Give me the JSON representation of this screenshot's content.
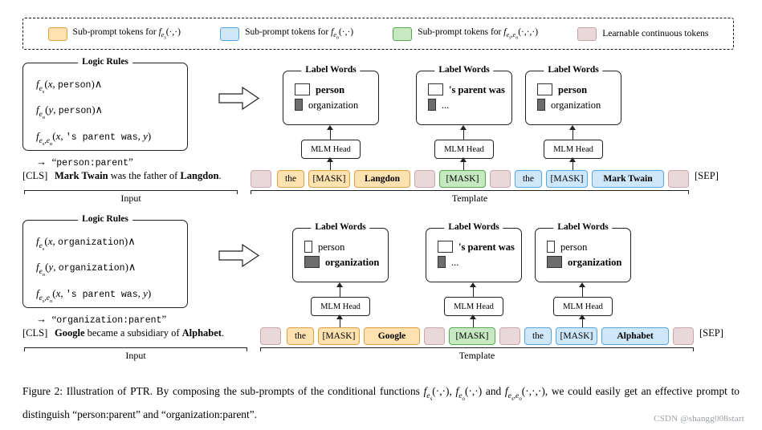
{
  "legend": {
    "items": [
      {
        "key": "es",
        "label": "Sub-prompt tokens for f_es(·,·)",
        "color": "#ffe2b0"
      },
      {
        "key": "eo",
        "label": "Sub-prompt tokens for f_eo(·,·)",
        "color": "#cfe7fb"
      },
      {
        "key": "eseo",
        "label": "Sub-prompt tokens for f_es,eo(·,·,·)",
        "color": "#c6e9c2"
      },
      {
        "key": "learn",
        "label": "Learnable continuous tokens",
        "color": "#ead7d9"
      }
    ]
  },
  "row1": {
    "logic": {
      "title": "Logic Rules",
      "lines": [
        "f_es(x, person)∧",
        "f_eo(y, person)∧",
        "f_es,eo(x, 's parent was, y)",
        "→ \"person:parent\""
      ],
      "l1_fn": "f",
      "l1_sub": "e_s",
      "l1_args": "(x, person)∧",
      "l2_fn": "f",
      "l2_sub": "e_o",
      "l2_args": "(y, person)∧",
      "l3_fn": "f",
      "l3_sub": "e_s,e_o",
      "l3_args": "(x, 's parent was, y)",
      "l4": "→ \"person:parent\""
    },
    "labelwords": [
      {
        "title": "Label Words",
        "lines": [
          "person",
          "organization"
        ],
        "bold_index": 0
      },
      {
        "title": "Label Words",
        "lines": [
          "'s parent was",
          "..."
        ],
        "bold_index": 0
      },
      {
        "title": "Label Words",
        "lines": [
          "person",
          "organization"
        ],
        "bold_index": 0
      }
    ],
    "mlm_label": "MLM Head",
    "sentence": {
      "cls": "[CLS]",
      "parts": [
        "Mark Twain",
        " was the father of ",
        "Langdon",
        "."
      ],
      "sep": "[SEP]"
    },
    "tokens": [
      {
        "type": "learn",
        "text": ""
      },
      {
        "type": "es",
        "text": "the"
      },
      {
        "type": "es",
        "text": "[MASK]"
      },
      {
        "type": "es",
        "text": "Langdon",
        "bold": true
      },
      {
        "type": "learn",
        "text": ""
      },
      {
        "type": "eseo",
        "text": "[MASK]"
      },
      {
        "type": "learn",
        "text": ""
      },
      {
        "type": "eo",
        "text": "the"
      },
      {
        "type": "eo",
        "text": "[MASK]"
      },
      {
        "type": "eo",
        "text": "Mark Twain",
        "bold": true
      },
      {
        "type": "learn",
        "text": ""
      }
    ],
    "underlines": {
      "input": "Input",
      "template": "Template"
    }
  },
  "row2": {
    "logic": {
      "title": "Logic Rules",
      "l1_fn": "f",
      "l1_sub": "e_s",
      "l1_args": "(x, organization)∧",
      "l2_fn": "f",
      "l2_sub": "e_o",
      "l2_args": "(y, organization)∧",
      "l3_fn": "f",
      "l3_sub": "e_s,e_o",
      "l3_args": "(x, 's parent was, y)",
      "l4": "→ \"organization:parent\""
    },
    "labelwords": [
      {
        "title": "Label Words",
        "lines": [
          "person",
          "organization"
        ],
        "bold_index": 1
      },
      {
        "title": "Label Words",
        "lines": [
          "'s parent was",
          "..."
        ],
        "bold_index": 0
      },
      {
        "title": "Label Words",
        "lines": [
          "person",
          "organization"
        ],
        "bold_index": 1
      }
    ],
    "mlm_label": "MLM Head",
    "sentence": {
      "cls": "[CLS]",
      "parts": [
        "Google",
        " became a subsidiary of ",
        "Alphabet",
        "."
      ],
      "sep": "[SEP]"
    },
    "tokens": [
      {
        "type": "learn",
        "text": ""
      },
      {
        "type": "es",
        "text": "the"
      },
      {
        "type": "es",
        "text": "[MASK]"
      },
      {
        "type": "es",
        "text": "Google",
        "bold": true
      },
      {
        "type": "learn",
        "text": ""
      },
      {
        "type": "eseo",
        "text": "[MASK]"
      },
      {
        "type": "learn",
        "text": ""
      },
      {
        "type": "eo",
        "text": "the"
      },
      {
        "type": "eo",
        "text": "[MASK]"
      },
      {
        "type": "eo",
        "text": "Alphabet",
        "bold": true
      },
      {
        "type": "learn",
        "text": ""
      }
    ],
    "underlines": {
      "input": "Input",
      "template": "Template"
    }
  },
  "caption": {
    "prefix": "Figure 2:",
    "text": " Illustration of PTR. By composing the sub-prompts of the conditional functions f_es(·,·), f_eo(·,·) and f_es,eo(·,·,·), we could easily get an effective prompt to distinguish \"person:parent\" and \"organization:parent\"."
  },
  "watermark": "CSDN @shangg008start"
}
